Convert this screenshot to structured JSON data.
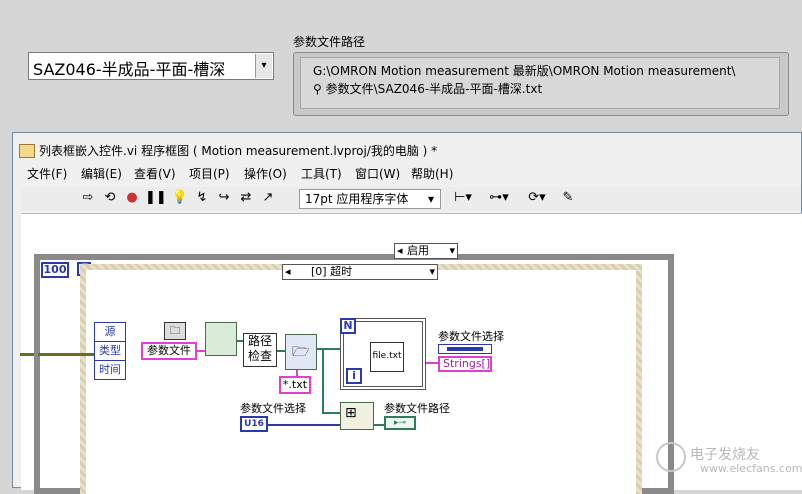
{
  "front_panel": {
    "combo": {
      "value": "SAZ046-半成品-平面-槽深",
      "arrow": "▾"
    },
    "path_label": "参数文件路径",
    "path_line1": "G:\\OMRON Motion measurement 最新版\\OMRON Motion measurement\\",
    "path_line2": "参数文件\\SAZ046-半成品-平面-槽深.txt"
  },
  "window": {
    "title": "列表框嵌入控件.vi 程序框图 ( Motion measurement.lvproj/我的电脑 )  *",
    "menu": [
      "文件(F)",
      "编辑(E)",
      "查看(V)",
      "项目(P)",
      "操作(O)",
      "工具(T)",
      "窗口(W)",
      "帮助(H)"
    ],
    "font": "17pt 应用程序字体"
  },
  "diagram": {
    "while_count": "100",
    "case_label": "启用",
    "event_label": "[0] 超时",
    "event_items": [
      "源",
      "类型",
      "时间"
    ],
    "const_param": "参数文件",
    "path_check": [
      "路径",
      "检查"
    ],
    "pattern": "*.txt",
    "loop_n": "N",
    "loop_i": "i",
    "file_node": "file.txt",
    "listbox_label": "参数文件选择",
    "strings_label": "Strings[]",
    "select_label": "参数文件选择",
    "u16": "U16",
    "path_indicator": "参数文件路径"
  },
  "watermark": {
    "line1": "电子发烧友",
    "line2": "www.elecfans.com"
  }
}
